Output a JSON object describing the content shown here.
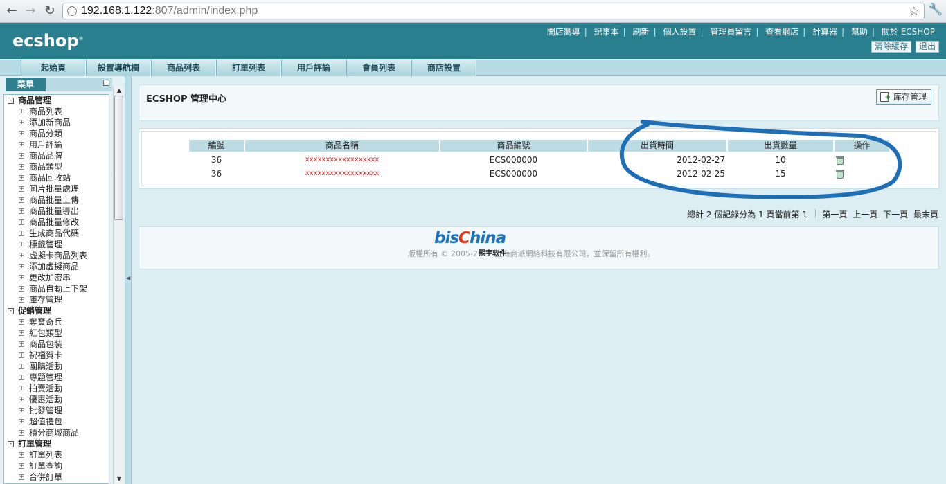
{
  "browser": {
    "url_host": "192.168.1.122",
    "url_rest": ":807/admin/index.php"
  },
  "header": {
    "logo": "ecshop",
    "top_links": [
      "開店嚮導",
      "記事本",
      "刷新",
      "個人設置",
      "管理員留言",
      "查看網店",
      "計算器",
      "幫助",
      "關於 ECSHOP"
    ],
    "clear_cache": "清除緩存",
    "logout": "退出"
  },
  "tabs": [
    "起始頁",
    "設置導航欄",
    "商品列表",
    "訂單列表",
    "用戶評論",
    "會員列表",
    "商店設置"
  ],
  "menu": {
    "title": "菜單",
    "groups": [
      {
        "label": "商品管理",
        "items": [
          "商品列表",
          "添加新商品",
          "商品分類",
          "用戶評論",
          "商品品牌",
          "商品類型",
          "商品回收站",
          "圖片批量處理",
          "商品批量上傳",
          "商品批量導出",
          "商品批量修改",
          "生成商品代碼",
          "標籤管理",
          "虛擬卡商品列表",
          "添加虛擬商品",
          "更改加密串",
          "商品自動上下架",
          "庫存管理"
        ]
      },
      {
        "label": "促銷管理",
        "items": [
          "奪寶奇兵",
          "紅包類型",
          "商品包裝",
          "祝福賀卡",
          "團購活動",
          "專題管理",
          "拍賣活動",
          "優惠活動",
          "批發管理",
          "超值禮包",
          "積分商城商品"
        ]
      },
      {
        "label": "訂單管理",
        "items": [
          "訂單列表",
          "訂單查詢",
          "合併訂單"
        ]
      }
    ]
  },
  "main": {
    "title": "ECSHOP 管理中心",
    "action_button": "库存管理",
    "columns": [
      "編號",
      "商品名稱",
      "商品編號",
      "出貨時間",
      "出貨數量",
      "操作"
    ],
    "rows": [
      {
        "id": "36",
        "name": "xxxxxxxxxxxxxxxxxx",
        "sn": "ECS000000",
        "date": "2012-02-27",
        "qty": "10"
      },
      {
        "id": "36",
        "name": "xxxxxxxxxxxxxxxxxx",
        "sn": "ECS000000",
        "date": "2012-02-25",
        "qty": "15"
      }
    ],
    "pager_summary": "總計 2 個記錄分為 1 頁當前第 1",
    "pager_links": [
      "第一頁",
      "上一頁",
      "下一頁",
      "最末頁"
    ],
    "footer": "版權所有 © 2005-2012 上海商派網絡科技有限公司，並保留所有權利。"
  },
  "watermark": {
    "text_a": "bis",
    "text_b": "hina",
    "sub": "熙宇软件"
  },
  "colors": {
    "header": "#2a7f8f",
    "annotation": "#1f6fb8",
    "product_name": "#e02020"
  }
}
